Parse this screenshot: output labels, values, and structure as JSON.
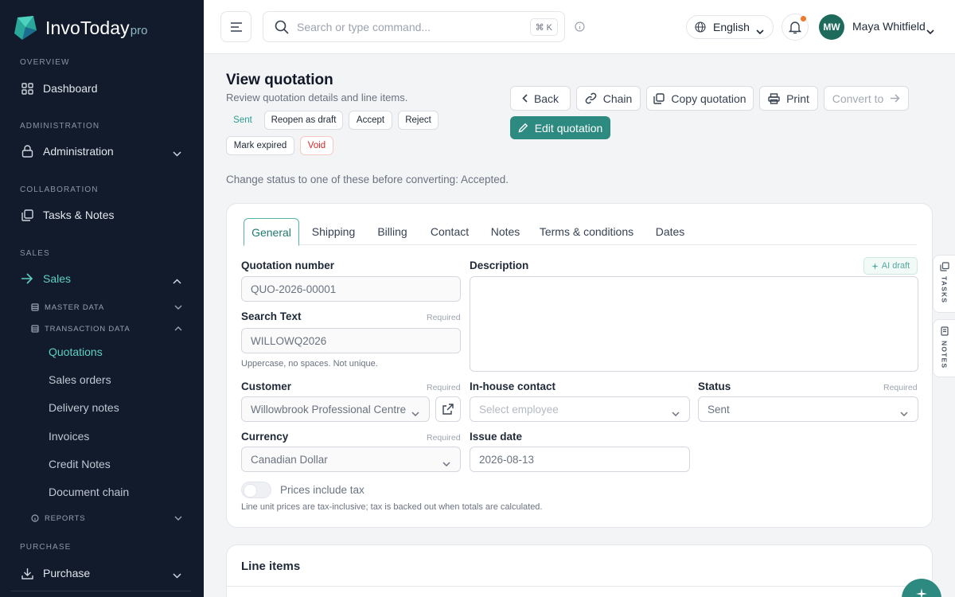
{
  "brand": {
    "name": "InvoToday",
    "suffix": "pro"
  },
  "sidebar": {
    "sections": {
      "overview": "OVERVIEW",
      "administration": "ADMINISTRATION",
      "collaboration": "COLLABORATION",
      "sales": "SALES",
      "purchase": "PURCHASE"
    },
    "items": {
      "dashboard": "Dashboard",
      "administration": "Administration",
      "tasks_notes": "Tasks & Notes",
      "sales": "Sales",
      "purchase": "Purchase"
    },
    "groups": {
      "master_data": "MASTER DATA",
      "transaction_data": "TRANSACTION DATA",
      "reports": "REPORTS"
    },
    "transaction_items": [
      "Quotations",
      "Sales orders",
      "Delivery notes",
      "Invoices",
      "Credit Notes",
      "Document chain"
    ]
  },
  "topbar": {
    "search_placeholder": "Search or type command...",
    "shortcut": "⌘ K",
    "language": "English",
    "user_initials": "MW",
    "user_name": "Maya Whitfield"
  },
  "page": {
    "title": "View quotation",
    "subtitle": "Review quotation details and line items.",
    "status_current": "Sent",
    "status_actions": [
      "Reopen as draft",
      "Accept",
      "Reject",
      "Mark expired",
      "Void"
    ],
    "actions": {
      "back": "Back",
      "chain": "Chain",
      "copy": "Copy quotation",
      "print": "Print",
      "convert": "Convert to",
      "edit": "Edit quotation"
    },
    "hint": "Change status to one of these before converting: Accepted."
  },
  "tabs": [
    "General",
    "Shipping",
    "Billing",
    "Contact",
    "Notes",
    "Terms & conditions",
    "Dates"
  ],
  "form": {
    "quotation_number": {
      "label": "Quotation number",
      "value": "QUO-2026-00001"
    },
    "description": {
      "label": "Description",
      "ai": "AI draft"
    },
    "search_text": {
      "label": "Search Text",
      "required": "Required",
      "value": "WILLOWQ2026",
      "help": "Uppercase, no spaces. Not unique."
    },
    "customer": {
      "label": "Customer",
      "required": "Required",
      "value": "Willowbrook Professional Centre"
    },
    "inhouse": {
      "label": "In-house contact",
      "placeholder": "Select employee"
    },
    "status": {
      "label": "Status",
      "required": "Required",
      "value": "Sent"
    },
    "currency": {
      "label": "Currency",
      "required": "Required",
      "value": "Canadian Dollar"
    },
    "issue_date": {
      "label": "Issue date",
      "value": "2026-08-13"
    },
    "tax": {
      "label": "Prices include tax",
      "help": "Line unit prices are tax-inclusive; tax is backed out when totals are calculated."
    }
  },
  "line_items": {
    "title": "Line items"
  },
  "side_tabs": {
    "tasks": "TASKS",
    "notes": "NOTES"
  },
  "colors": {
    "sidebar_bg": "#111b2b",
    "accent": "#2c8a80",
    "active_nav": "#5fd0c1",
    "danger": "#dc2626"
  }
}
